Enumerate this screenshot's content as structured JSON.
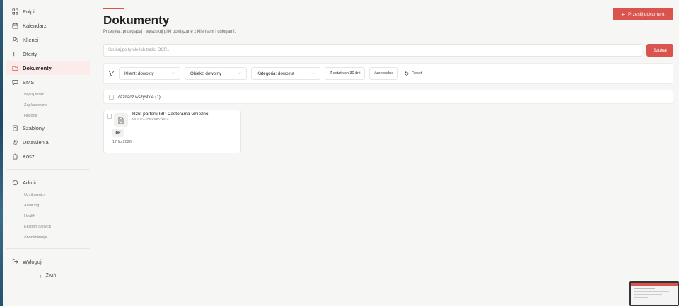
{
  "sidebar": {
    "items": [
      {
        "label": "Pulpit",
        "icon": "dashboard-icon"
      },
      {
        "label": "Kalendarz",
        "icon": "calendar-icon"
      },
      {
        "label": "Klienci",
        "icon": "users-icon"
      },
      {
        "label": "Oferty",
        "icon": "offers-icon"
      },
      {
        "label": "Dokumenty",
        "icon": "folder-icon",
        "active": true
      },
      {
        "label": "SMS",
        "icon": "message-icon"
      }
    ],
    "sms_sub": [
      "Wyślij teraz",
      "Zaplanowane",
      "Historia"
    ],
    "items2": [
      {
        "label": "Szablony",
        "icon": "template-icon"
      },
      {
        "label": "Ustawienia",
        "icon": "gear-icon"
      },
      {
        "label": "Kosz",
        "icon": "trash-icon"
      }
    ],
    "admin": {
      "label": "Admin",
      "icon": "shield-icon"
    },
    "admin_sub": [
      "Użytkownicy",
      "Audit log",
      "Health",
      "Eksport danych",
      "Anonimizacja"
    ],
    "logout": "Wyloguj",
    "collapse": "Zwiń"
  },
  "header": {
    "title": "Dokumenty",
    "subtitle": "Przesyłaj, przeglądaj i wyszukuj pliki powiązane z klientami i usługami.",
    "upload_button": "Prześlij dokument"
  },
  "search": {
    "placeholder": "Szukaj po tytule lub treści OCR...",
    "button": "Szukaj"
  },
  "filters": {
    "client": "Klient: dowolny",
    "object": "Obiekt: dowolny",
    "category": "Kategoria: dowolna",
    "last30": "Z ostatnich 30 dni",
    "archived": "Archiwalne",
    "reset": "Reset"
  },
  "select_all": "Zaznacz wszystkie (1)",
  "documents": [
    {
      "title": "Rzut parteru IBP Castorama Gniezno",
      "client": "MICHAŁ POŁCZYŃSKI",
      "tag": "BP",
      "date": "17 lip 2026"
    }
  ],
  "colors": {
    "accent": "#d9534f",
    "active_bg": "#fbeceb",
    "background": "#f6f6f5"
  }
}
